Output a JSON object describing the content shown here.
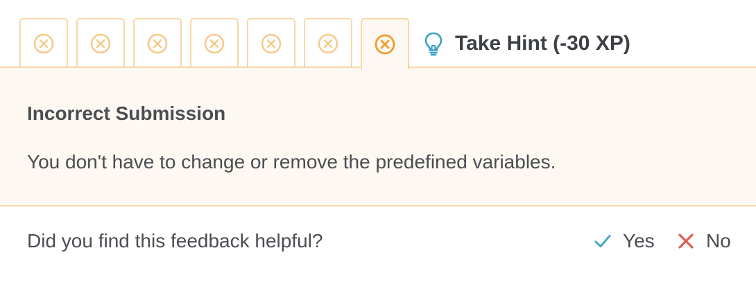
{
  "attempts": [
    {
      "status": "incorrect",
      "icon": "x-circle-icon",
      "active": false
    },
    {
      "status": "incorrect",
      "icon": "x-circle-icon",
      "active": false
    },
    {
      "status": "incorrect",
      "icon": "x-circle-icon",
      "active": false
    },
    {
      "status": "incorrect",
      "icon": "x-circle-icon",
      "active": false
    },
    {
      "status": "incorrect",
      "icon": "x-circle-icon",
      "active": false
    },
    {
      "status": "incorrect",
      "icon": "x-circle-icon",
      "active": false
    },
    {
      "status": "incorrect",
      "icon": "x-circle-icon",
      "active": true
    }
  ],
  "hint": {
    "icon": "lightbulb-icon",
    "label": "Take Hint (-30 XP)"
  },
  "feedback": {
    "title": "Incorrect Submission",
    "message": "You don't have to change or remove the predefined variables."
  },
  "helpful": {
    "question": "Did you find this feedback helpful?",
    "yes_label": "Yes",
    "yes_icon": "checkmark-icon",
    "no_label": "No",
    "no_icon": "x-icon"
  },
  "colors": {
    "tab_border": "#f8d6a6",
    "icon_inactive": "#f6c98a",
    "icon_active": "#f09a2e",
    "panel_background": "#fdf8f1",
    "hint_icon": "#3aa0c4",
    "yes_icon": "#4fa8c7",
    "no_icon": "#e05a4f",
    "text": "#4a4d52"
  }
}
